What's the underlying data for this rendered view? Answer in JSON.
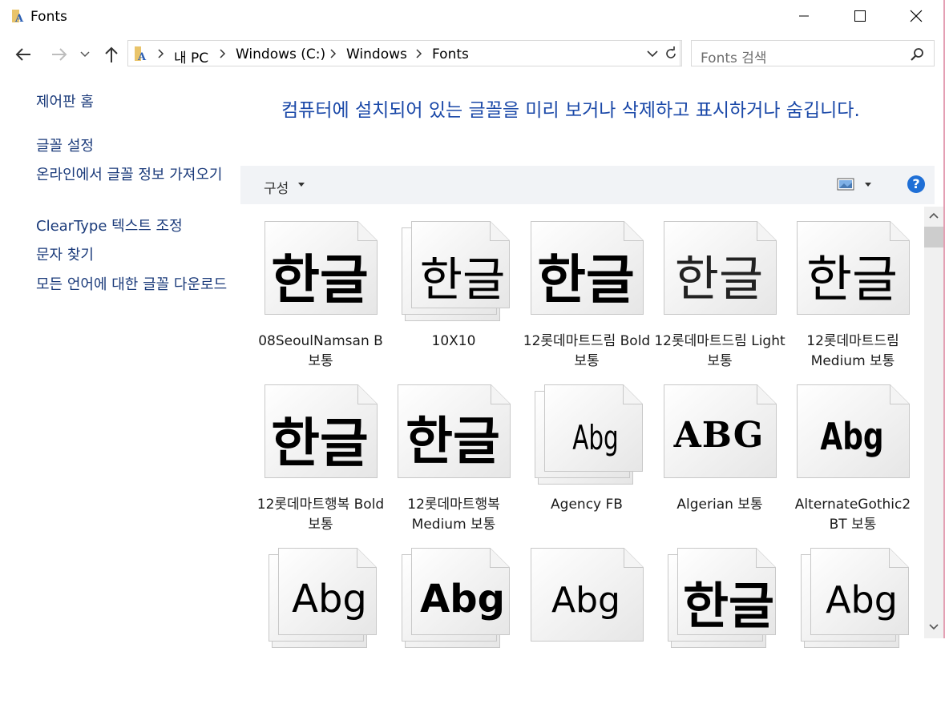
{
  "window": {
    "title": "Fonts",
    "icon": "fonts-folder-icon"
  },
  "nav": {
    "breadcrumb": [
      "내 PC",
      "Windows (C:)",
      "Windows",
      "Fonts"
    ],
    "search_placeholder": "Fonts 검색"
  },
  "sidebar": {
    "items": [
      {
        "label": "제어판 홈"
      },
      {
        "label": "글꼴 설정"
      },
      {
        "label": "온라인에서 글꼴 정보 가져오기"
      },
      {
        "label": "ClearType 텍스트 조정"
      },
      {
        "label": "문자 찾기"
      },
      {
        "label": "모든 언어에 대한 글꼴 다운로드"
      }
    ]
  },
  "header": {
    "description": "컴퓨터에 설치되어 있는 글꼴을 미리 보거나 삭제하고 표시하거나 숨깁니다."
  },
  "toolbar": {
    "organize_label": "구성",
    "help_label": "?"
  },
  "fonts": [
    {
      "preview": "한글",
      "name": "08SeoulNamsan B 보통",
      "stacked": false
    },
    {
      "preview": "한글",
      "name": "10X10",
      "stacked": true
    },
    {
      "preview": "한글",
      "name": "12롯데마트드림 Bold 보통",
      "stacked": false
    },
    {
      "preview": "한글",
      "name": "12롯데마트드림 Light 보통",
      "stacked": false
    },
    {
      "preview": "한글",
      "name": "12롯데마트드림 Medium 보통",
      "stacked": false
    },
    {
      "preview": "한글",
      "name": "12롯데마트행복 Bold 보통",
      "stacked": false
    },
    {
      "preview": "한글",
      "name": "12롯데마트행복 Medium 보통",
      "stacked": false
    },
    {
      "preview": "Abg",
      "name": "Agency FB",
      "stacked": true
    },
    {
      "preview": "ABG",
      "name": "Algerian 보통",
      "stacked": false
    },
    {
      "preview": "Abg",
      "name": "AlternateGothic2 BT 보통",
      "stacked": false
    },
    {
      "preview": "Abg",
      "name": "",
      "stacked": true
    },
    {
      "preview": "Abg",
      "name": "",
      "stacked": true
    },
    {
      "preview": "Abg",
      "name": "",
      "stacked": false
    },
    {
      "preview": "한글",
      "name": "",
      "stacked": true
    },
    {
      "preview": "Abg",
      "name": "",
      "stacked": true
    }
  ]
}
